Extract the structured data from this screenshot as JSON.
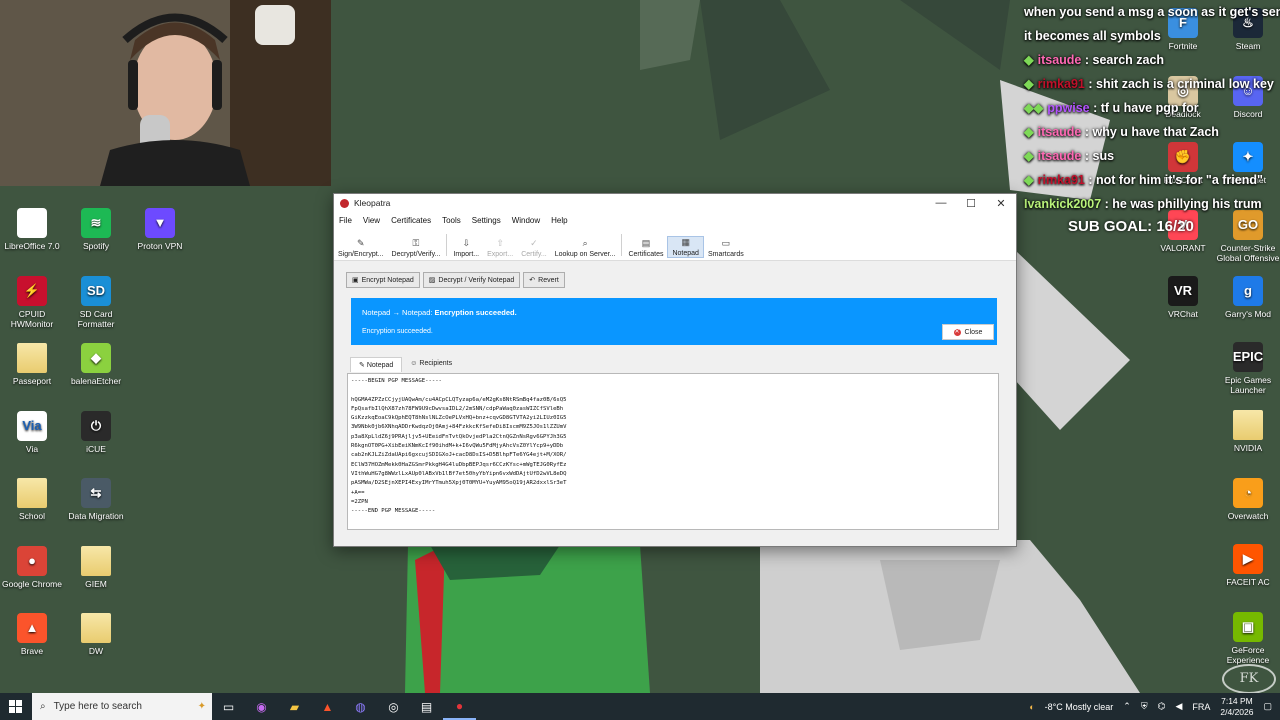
{
  "desktop": {
    "left_icons": [
      {
        "label": "LibreOffice 7.0",
        "glyph": "",
        "color": "#ffffff",
        "icon": "document-icon"
      },
      {
        "label": "Spotify",
        "glyph": "≋",
        "color": "#1db954",
        "icon": "spotify-icon"
      },
      {
        "label": "Proton VPN",
        "glyph": "▼",
        "color": "#6d4aff",
        "icon": "proton-vpn-icon"
      },
      {
        "label": "CPUID HWMonitor",
        "glyph": "⚡",
        "color": "#c8102e",
        "icon": "hwmonitor-icon"
      },
      {
        "label": "SD Card Formatter",
        "glyph": "SD",
        "color": "#1a8fd6",
        "icon": "sd-card-icon"
      },
      {
        "label": "Passeport",
        "glyph": "",
        "color": "folder",
        "icon": "folder-icon"
      },
      {
        "label": "balenaEtcher",
        "glyph": "◆",
        "color": "#8bd13f",
        "icon": "balena-etcher-icon"
      },
      {
        "label": "Via",
        "glyph": "Via",
        "color": "#ffffff",
        "icon": "via-icon"
      },
      {
        "label": "iCUE",
        "glyph": "⏻",
        "color": "#2a2a2a",
        "icon": "icue-icon"
      },
      {
        "label": "School",
        "glyph": "",
        "color": "folder",
        "icon": "folder-icon"
      },
      {
        "label": "Data Migration",
        "glyph": "⇆",
        "color": "#4a5a66",
        "icon": "data-migration-icon"
      },
      {
        "label": "Google Chrome",
        "glyph": "●",
        "color": "#db4437",
        "icon": "chrome-icon"
      },
      {
        "label": "GIEM",
        "glyph": "",
        "color": "folder",
        "icon": "folder-icon"
      },
      {
        "label": "Brave",
        "glyph": "▲",
        "color": "#fb542b",
        "icon": "brave-icon"
      },
      {
        "label": "DW",
        "glyph": "",
        "color": "folder",
        "icon": "folder-icon"
      }
    ],
    "right_icons": [
      {
        "label": "Fortnite",
        "glyph": "F",
        "color": "#3a8fe0",
        "icon": "fortnite-icon"
      },
      {
        "label": "Steam",
        "glyph": "♨",
        "color": "#1b2838",
        "icon": "steam-icon"
      },
      {
        "label": "Deadlock",
        "glyph": "◎",
        "color": "#d9c7a0",
        "icon": "deadlock-icon"
      },
      {
        "label": "Discord",
        "glyph": "☺",
        "color": "#5865f2",
        "icon": "discord-icon"
      },
      {
        "label": "Riot Client",
        "glyph": "✊",
        "color": "#d13639",
        "icon": "riot-client-icon"
      },
      {
        "label": "Battle.net",
        "glyph": "✦",
        "color": "#148eff",
        "icon": "battlenet-icon"
      },
      {
        "label": "VALORANT",
        "glyph": "V",
        "color": "#ff4655",
        "icon": "valorant-icon"
      },
      {
        "label": "Counter-Strike Global Offensive",
        "glyph": "GO",
        "color": "#e09a2b",
        "icon": "csgo-icon"
      },
      {
        "label": "VRChat",
        "glyph": "VR",
        "color": "#1a1a1a",
        "icon": "vrchat-icon"
      },
      {
        "label": "Garry's Mod",
        "glyph": "g",
        "color": "#1e7ae8",
        "icon": "garrys-mod-icon"
      },
      {
        "label": "Epic Games Launcher",
        "glyph": "EPIC",
        "color": "#2a2a2a",
        "icon": "epic-games-icon"
      },
      {
        "label": "NVIDIA",
        "glyph": "",
        "color": "folder",
        "icon": "folder-icon"
      },
      {
        "label": "Overwatch",
        "glyph": "◔",
        "color": "#f99e1a",
        "icon": "overwatch-icon"
      },
      {
        "label": "FACEIT AC",
        "glyph": "▶",
        "color": "#ff5500",
        "icon": "faceit-icon"
      },
      {
        "label": "GeForce Experience",
        "glyph": "▣",
        "color": "#76b900",
        "icon": "geforce-icon"
      }
    ]
  },
  "chat": {
    "lines": [
      {
        "user": "",
        "text": "when you send a msg a soon as it get's sent",
        "color": "#ffffff",
        "badge": ""
      },
      {
        "user": "",
        "text": "it becomes all symbols",
        "color": "#ffffff",
        "badge": ""
      },
      {
        "user": "itsaude",
        "text": ": search zach",
        "color": "#ff69b4",
        "badge": "◆"
      },
      {
        "user": "rimka91",
        "text": ": shit zach is a criminal low key",
        "color": "#c0102a",
        "badge": "◆"
      },
      {
        "user": "ppwise",
        "text": ": tf u have pgp for",
        "color": "#b455ff",
        "badge": "◆◆"
      },
      {
        "user": "itsaude",
        "text": ": why u have that Zach",
        "color": "#ff69b4",
        "badge": "◆"
      },
      {
        "user": "itsaude",
        "text": ": sus",
        "color": "#ff69b4",
        "badge": "◆"
      },
      {
        "user": "rimka91",
        "text": ": not for him it's for \"a friend\"",
        "color": "#c0102a",
        "badge": "◆"
      },
      {
        "user": "Ivankick2007",
        "text": ": he was phillying his trum",
        "color": "#b9f27a",
        "badge": ""
      }
    ],
    "sub_goal": "SUB GOAL: 16/20"
  },
  "kleopatra": {
    "title": "Kleopatra",
    "menu": [
      "File",
      "View",
      "Certificates",
      "Tools",
      "Settings",
      "Window",
      "Help"
    ],
    "toolbar": [
      {
        "label": "Sign/Encrypt...",
        "icon": "sign-encrypt-icon",
        "glyph": "✎",
        "enabled": true,
        "active": false
      },
      {
        "label": "Decrypt/Verify...",
        "icon": "decrypt-verify-icon",
        "glyph": "⚿",
        "enabled": true,
        "active": false
      },
      {
        "label": "Import...",
        "icon": "import-icon",
        "glyph": "⇩",
        "enabled": true,
        "active": false
      },
      {
        "label": "Export...",
        "icon": "export-icon",
        "glyph": "⇧",
        "enabled": false,
        "active": false
      },
      {
        "label": "Certify...",
        "icon": "certify-icon",
        "glyph": "✓",
        "enabled": false,
        "active": false
      },
      {
        "label": "Lookup on Server...",
        "icon": "search-icon",
        "glyph": "⌕",
        "enabled": true,
        "active": false
      },
      {
        "label": "Certificates",
        "icon": "certificates-icon",
        "glyph": "▤",
        "enabled": true,
        "active": false
      },
      {
        "label": "Notepad",
        "icon": "notepad-icon",
        "glyph": "▦",
        "enabled": true,
        "active": true
      },
      {
        "label": "Smartcards",
        "icon": "smartcard-icon",
        "glyph": "▭",
        "enabled": true,
        "active": false
      }
    ],
    "actions": {
      "encrypt": "Encrypt Notepad",
      "decrypt": "Decrypt / Verify Notepad",
      "revert": "Revert"
    },
    "banner": {
      "line1_prefix": "Notepad → Notepad: ",
      "line1_bold": "Encryption succeeded.",
      "line2": "Encryption succeeded.",
      "close": "Close"
    },
    "tabs": {
      "notepad": "Notepad",
      "recipients": "Recipients"
    },
    "message": "-----BEGIN PGP MESSAGE-----\n\nhQGMA4ZPZzCCjyjUAQwAm/cu4ACpCLQTyzap6a/eM2gKs8NtRSmBq4faz0B/6sQ5\nFpQsafbIlQhX87zh78FW9U9cDwvsaIDL2/2mSNN/cdpPaWaq0zasWIZCfSVleBh\nGiKzzkqEoaC9kQphEQT8hNslNLZcOePLVxHQ+bnz+cqvGD8GTVTA2yi2LIUz0IG5\n3W9Nbk0jb6XNhqADDrKwdqzOj0Amj+84FzkkcKfSefeDi8IscmM9Z5JOs1lZZUmV\np3a8XpLldZ6j9PRAjljv5+UEeidFnTvtQkOvjedPla2CtnQGZnNsRgv6GPYJh3G5\nR6kgnOT0PG+XibEeiKNmKcIf90ihdM+k+I6vQWu5FdMjyAhcVsZ0YlYcp9+yDDb\ncab2nKJLZiZdaUApi6gxcujSDIGXoJ+cacD8DsIS+D5BlhpFTe6YG4ejt+M/XOR/\nEClW37HOZmMekk0HaZGSmrPkkgH4G4luDbpBEPJqsr6CCzKYsc+mWgTEJG0RyfEz\nVIthWuHG7g8WWzlLxAUp0lABxVb1lBf7et50hyYbYipn6vxWdDAjtUfD2wVL8eDQ\npASMWa/D2SEjnXEPI4ExyIMrYTmuh5Xpj0T0MYU+YuyAM95oQ19jAR2dxxlSr3eT\n+A==\n=2ZPN\n-----END PGP MESSAGE-----"
  },
  "taskbar": {
    "search_placeholder": "Type here to search",
    "weather": "-8°C  Mostly clear",
    "language": "FRA",
    "time": "7:14 PM",
    "date": "2/4/2026"
  },
  "watermark": "FK"
}
